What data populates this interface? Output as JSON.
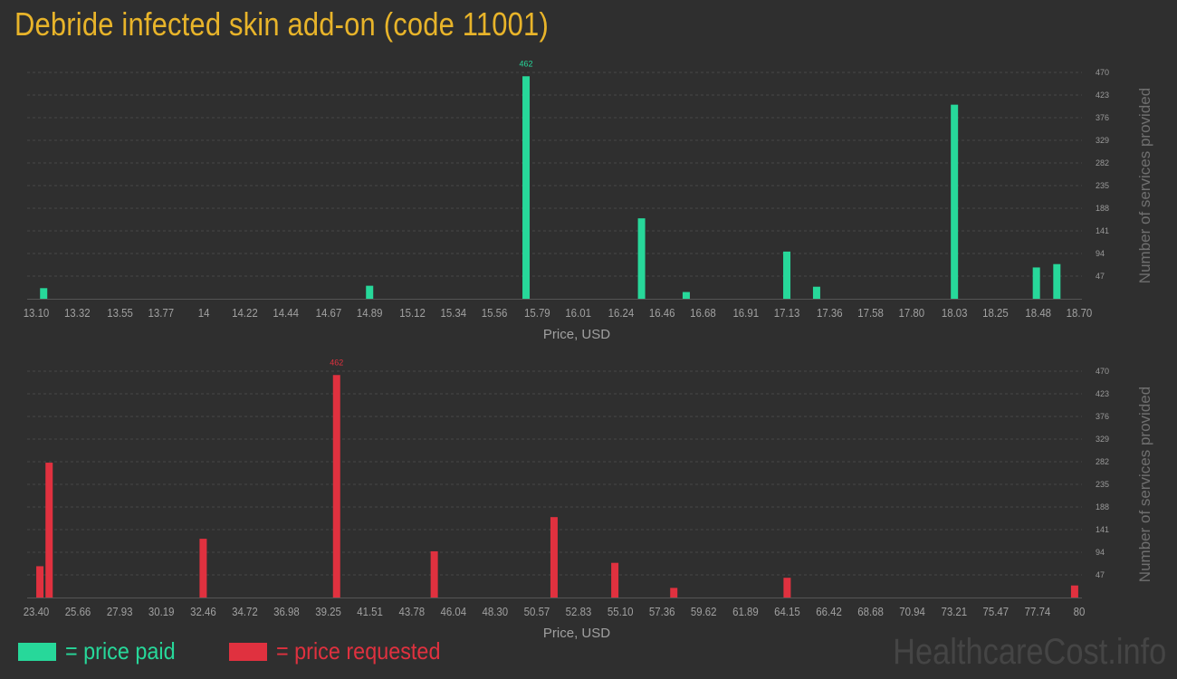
{
  "title": "Debride infected skin add-on (code 11001)",
  "colors": {
    "paid": "#27d89a",
    "requested": "#e0313f",
    "title": "#e8b42a"
  },
  "legend": [
    {
      "key": "paid",
      "label": "= price paid"
    },
    {
      "key": "requested",
      "label": "= price requested"
    }
  ],
  "watermark": "HealthcareCost.info",
  "chart_data": [
    {
      "type": "bar",
      "color_key": "paid",
      "xlabel": "Price, USD",
      "ylabel": "Number of services provided",
      "y_ticks": [
        47,
        94,
        141,
        188,
        235,
        282,
        329,
        376,
        423,
        470
      ],
      "ylim": [
        0,
        470
      ],
      "x_tick_labels": [
        "13.10",
        "13.32",
        "13.55",
        "13.77",
        "14",
        "14.22",
        "14.44",
        "14.67",
        "14.89",
        "15.12",
        "15.34",
        "15.56",
        "15.79",
        "16.01",
        "16.24",
        "16.46",
        "16.68",
        "16.91",
        "17.13",
        "17.36",
        "17.58",
        "17.80",
        "18.03",
        "18.25",
        "18.48",
        "18.70"
      ],
      "x_ticks": [
        13.1,
        13.32,
        13.55,
        13.77,
        14.0,
        14.22,
        14.44,
        14.67,
        14.89,
        15.12,
        15.34,
        15.56,
        15.79,
        16.01,
        16.24,
        16.46,
        16.68,
        16.91,
        17.13,
        17.36,
        17.58,
        17.8,
        18.03,
        18.25,
        18.48,
        18.7
      ],
      "xlim": [
        13.1,
        18.7
      ],
      "grid": true,
      "peak_label": "462",
      "bars": [
        {
          "x": 13.14,
          "y": 22
        },
        {
          "x": 14.89,
          "y": 27
        },
        {
          "x": 15.73,
          "y": 462,
          "label": "462"
        },
        {
          "x": 16.35,
          "y": 167
        },
        {
          "x": 16.59,
          "y": 14
        },
        {
          "x": 17.13,
          "y": 98
        },
        {
          "x": 17.29,
          "y": 25
        },
        {
          "x": 18.03,
          "y": 403
        },
        {
          "x": 18.47,
          "y": 65
        },
        {
          "x": 18.58,
          "y": 72
        }
      ]
    },
    {
      "type": "bar",
      "color_key": "requested",
      "xlabel": "Price, USD",
      "ylabel": "Number of services provided",
      "y_ticks": [
        47,
        94,
        141,
        188,
        235,
        282,
        329,
        376,
        423,
        470
      ],
      "ylim": [
        0,
        470
      ],
      "x_tick_labels": [
        "23.40",
        "25.66",
        "27.93",
        "30.19",
        "32.46",
        "34.72",
        "36.98",
        "39.25",
        "41.51",
        "43.78",
        "46.04",
        "48.30",
        "50.57",
        "52.83",
        "55.10",
        "57.36",
        "59.62",
        "61.89",
        "64.15",
        "66.42",
        "68.68",
        "70.94",
        "73.21",
        "75.47",
        "77.74",
        "80"
      ],
      "x_ticks": [
        23.4,
        25.66,
        27.93,
        30.19,
        32.46,
        34.72,
        36.98,
        39.25,
        41.51,
        43.78,
        46.04,
        48.3,
        50.57,
        52.83,
        55.1,
        57.36,
        59.62,
        61.89,
        64.15,
        66.42,
        68.68,
        70.94,
        73.21,
        75.47,
        77.74,
        80.0
      ],
      "xlim": [
        23.4,
        80.0
      ],
      "grid": true,
      "peak_label": "462",
      "bars": [
        {
          "x": 23.6,
          "y": 65
        },
        {
          "x": 24.1,
          "y": 280
        },
        {
          "x": 32.46,
          "y": 122
        },
        {
          "x": 39.7,
          "y": 462,
          "label": "462"
        },
        {
          "x": 45.0,
          "y": 96
        },
        {
          "x": 51.5,
          "y": 167
        },
        {
          "x": 54.8,
          "y": 72
        },
        {
          "x": 58.0,
          "y": 20
        },
        {
          "x": 64.15,
          "y": 41
        },
        {
          "x": 79.75,
          "y": 25
        }
      ]
    }
  ]
}
